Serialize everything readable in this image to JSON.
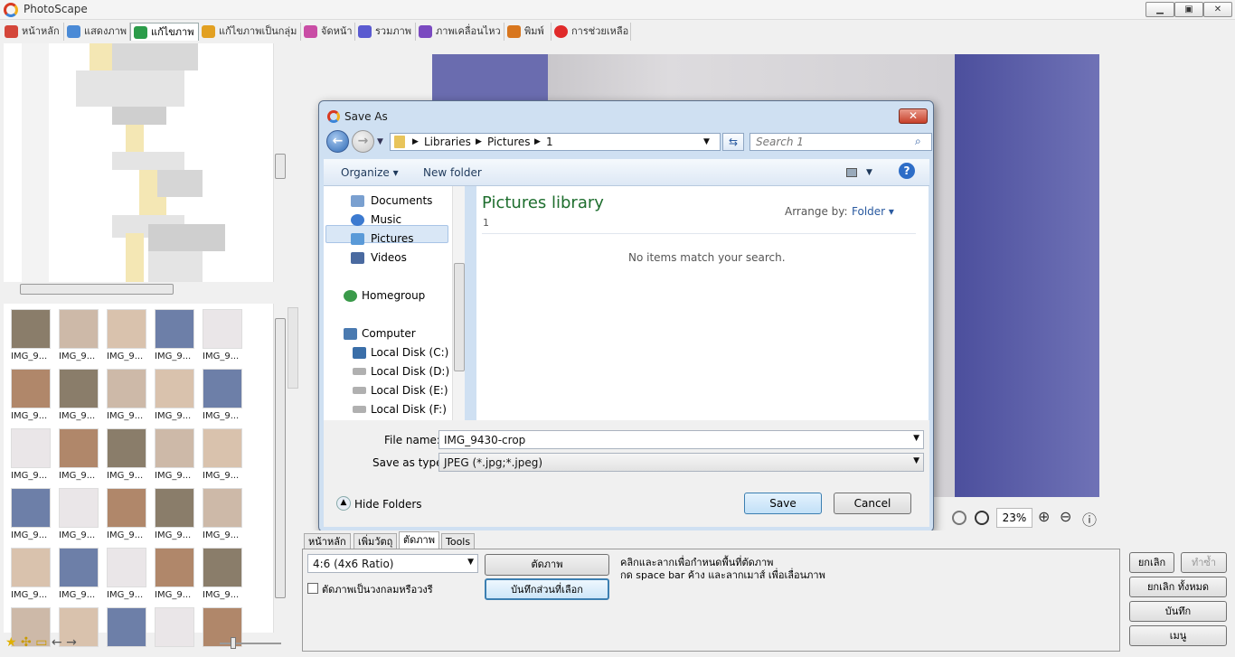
{
  "app": {
    "title": "PhotoScape"
  },
  "window_buttons": [
    "▁",
    "▣",
    "✕"
  ],
  "menu": {
    "tabs": [
      {
        "label": "หน้าหลัก",
        "color": "#d4463a"
      },
      {
        "label": "แสดงภาพ",
        "color": "#4a8ad6"
      },
      {
        "label": "แก้ไขภาพ",
        "color": "#2b9c4a"
      },
      {
        "label": "แก้ไขภาพเป็นกลุ่ม",
        "color": "#e2a022"
      },
      {
        "label": "จัดหน้า",
        "color": "#c94da5"
      },
      {
        "label": "รวมภาพ",
        "color": "#5a5ad0"
      },
      {
        "label": "ภาพเคลื่อนไหว",
        "color": "#7a4ac0"
      },
      {
        "label": "พิมพ์",
        "color": "#d8761e"
      },
      {
        "label": "การช่วยเหลือ",
        "color": "#e02a2a"
      }
    ],
    "active": 2
  },
  "thumbnails": {
    "label": "IMG_9...",
    "rows": 6,
    "cols": 5
  },
  "dialog": {
    "title": "Save As",
    "close_label": "✕",
    "path": [
      "Libraries",
      "Pictures",
      "1"
    ],
    "search_placeholder": "Search 1",
    "organize": "Organize ▾",
    "new_folder": "New folder",
    "nav_items": [
      {
        "label": "Documents",
        "icon": "documents-icon",
        "color": "#7aa0d0"
      },
      {
        "label": "Music",
        "icon": "music-icon",
        "color": "#3c7ad0"
      },
      {
        "label": "Pictures",
        "icon": "pictures-icon",
        "color": "#5a9ad8",
        "selected": true
      },
      {
        "label": "Videos",
        "icon": "videos-icon",
        "color": "#4a6aa0"
      }
    ],
    "homegroup": "Homegroup",
    "computer": "Computer",
    "drives": [
      "Local Disk (C:)",
      "Local Disk (D:)",
      "Local Disk (E:)",
      "Local Disk (F:)"
    ],
    "library_title": "Pictures library",
    "library_sub": "1",
    "arrange_label": "Arrange by:",
    "arrange_value": "Folder",
    "empty_msg": "No items match your search.",
    "file_name_label": "File name:",
    "file_name": "IMG_9430-crop",
    "save_type_label": "Save as type:",
    "save_type": "JPEG (*.jpg;*.jpeg)",
    "hide_folders": "Hide Folders",
    "save": "Save",
    "cancel": "Cancel"
  },
  "zoom": {
    "value": "23%"
  },
  "bottom": {
    "tabs": [
      "หน้าหลัก",
      "เพิ่มวัตถุ",
      "ตัดภาพ",
      "Tools"
    ],
    "active_tab": 2,
    "ratio": "4:6 (4x6 Ratio)",
    "crop_btn": "ตัดภาพ",
    "save_sel_btn": "บันทึกส่วนที่เลือก",
    "circle_crop": "ตัดภาพเป็นวงกลมหรือวงรี",
    "hint1": "คลิกและลากเพื่อกำหนดพื้นที่ตัดภาพ",
    "hint2": "กด space bar ค้าง และลากเมาส์ เพื่อเลื่อนภาพ",
    "undo": "ยกเลิก",
    "redo": "ทำซ้ำ",
    "undo_all": "ยกเลิก ทั้งหมด",
    "save": "บันทึก",
    "menu": "เมนู"
  }
}
